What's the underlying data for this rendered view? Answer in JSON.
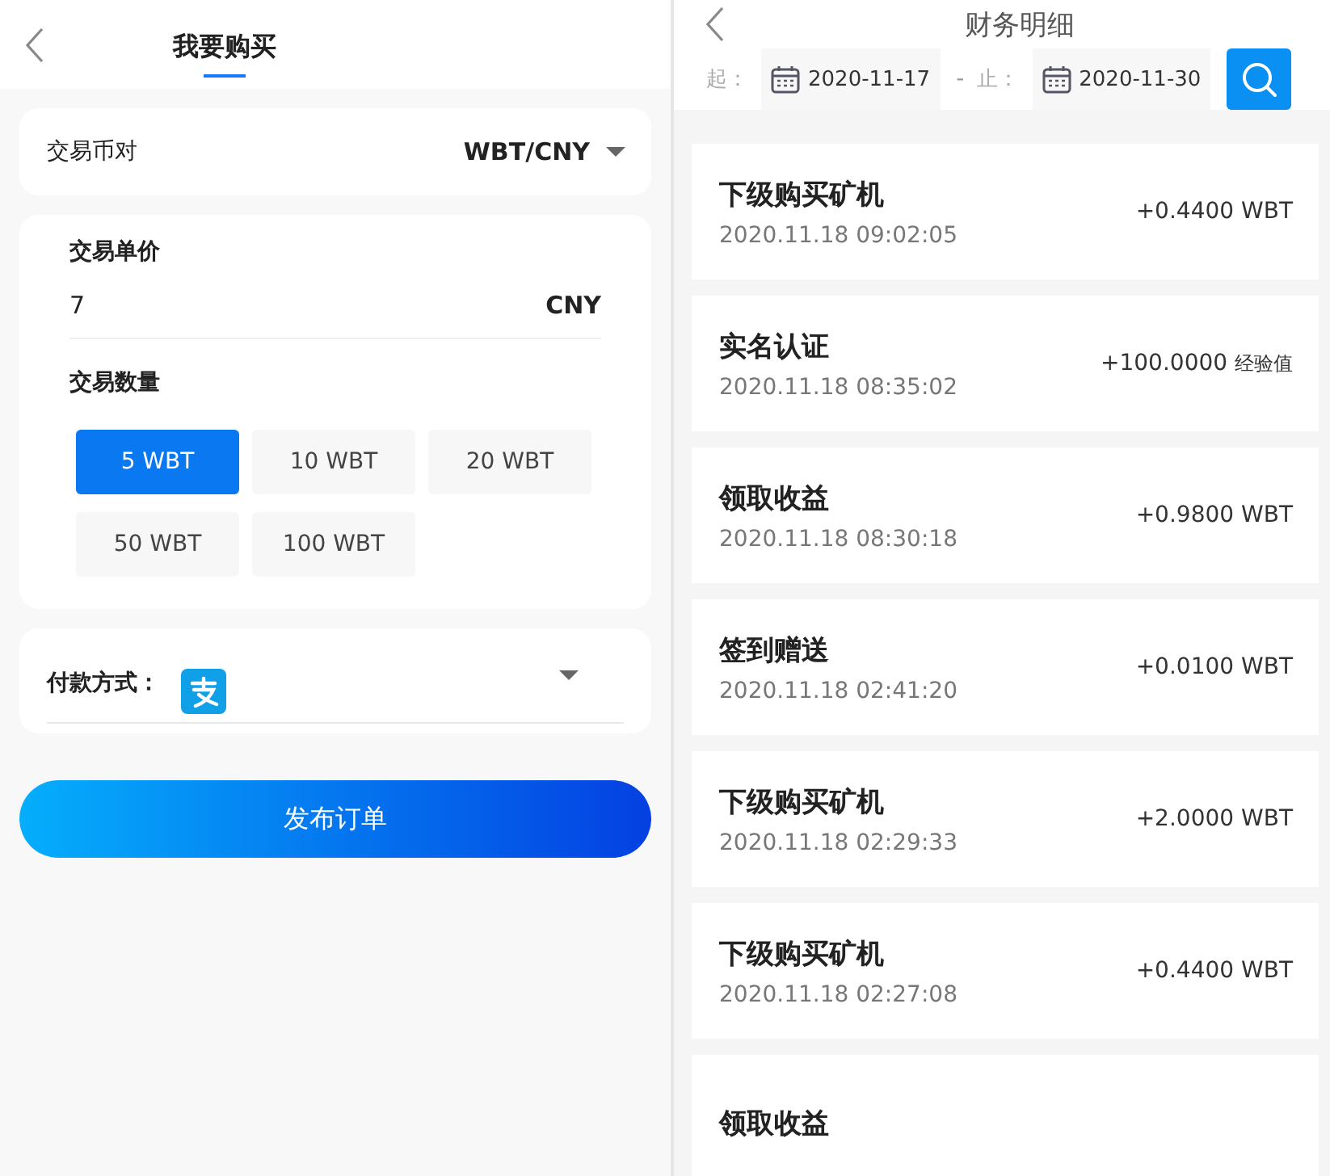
{
  "buy_panel": {
    "header": {
      "title": "我要购买"
    },
    "pair": {
      "label": "交易币对",
      "value": "WBT/CNY"
    },
    "price": {
      "label": "交易单价",
      "value": "7",
      "unit": "CNY"
    },
    "quantity": {
      "label": "交易数量",
      "options": [
        {
          "label": "5 WBT",
          "selected": true
        },
        {
          "label": "10 WBT",
          "selected": false
        },
        {
          "label": "20 WBT",
          "selected": false
        },
        {
          "label": "50 WBT",
          "selected": false
        },
        {
          "label": "100 WBT",
          "selected": false
        }
      ]
    },
    "payment": {
      "label": "付款方式："
    },
    "submit": "发布订单"
  },
  "finance_panel": {
    "header": {
      "title": "财务明细"
    },
    "filter": {
      "start_label": "起：",
      "start_date": "2020-11-17",
      "separator": "-",
      "end_label": "止：",
      "end_date": "2020-11-30"
    },
    "records": [
      {
        "title": "下级购买矿机",
        "time": "2020.11.18 09:02:05",
        "amount": "+0.4400 WBT"
      },
      {
        "title": "实名认证",
        "time": "2020.11.18 08:35:02",
        "amount": "+100.0000",
        "unit": "经验值"
      },
      {
        "title": "领取收益",
        "time": "2020.11.18 08:30:18",
        "amount": "+0.9800 WBT"
      },
      {
        "title": "签到赠送",
        "time": "2020.11.18 02:41:20",
        "amount": "+0.0100 WBT"
      },
      {
        "title": "下级购买矿机",
        "time": "2020.11.18 02:29:33",
        "amount": "+2.0000 WBT"
      },
      {
        "title": "下级购买矿机",
        "time": "2020.11.18 02:27:08",
        "amount": "+0.4400 WBT"
      },
      {
        "title": "领取收益"
      }
    ]
  }
}
